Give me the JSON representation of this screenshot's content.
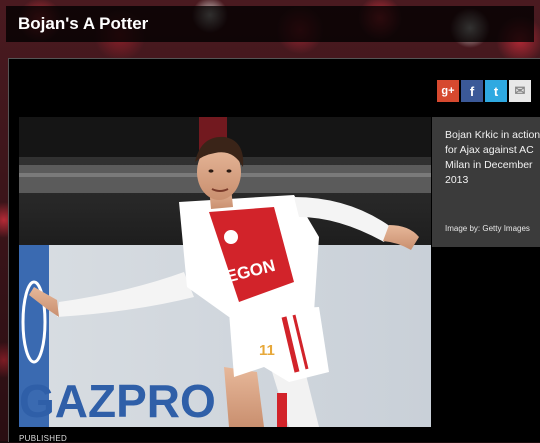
{
  "header": {
    "title": "Bojan's A Potter"
  },
  "share": {
    "googleplus_glyph": "g+",
    "facebook_glyph": "f",
    "twitter_glyph": "t",
    "email_glyph": "✉",
    "colors": {
      "googleplus": "#d6492f",
      "facebook": "#3b5998",
      "twitter": "#2fa9e1",
      "email": "#e9e9e9"
    }
  },
  "photo": {
    "board_text": "GAZPRO",
    "shirt_sponsor": "AEGON",
    "shorts_number": "11",
    "caption": "Bojan Krkic in action for Ajax against AC Milan in December 2013",
    "credit": "Image by: Getty Images"
  },
  "footer": {
    "label": "PUBLISHED"
  },
  "colors": {
    "panel": "#000000",
    "caption_bg": "#3b3b3b",
    "ajax_red": "#d2232a"
  }
}
